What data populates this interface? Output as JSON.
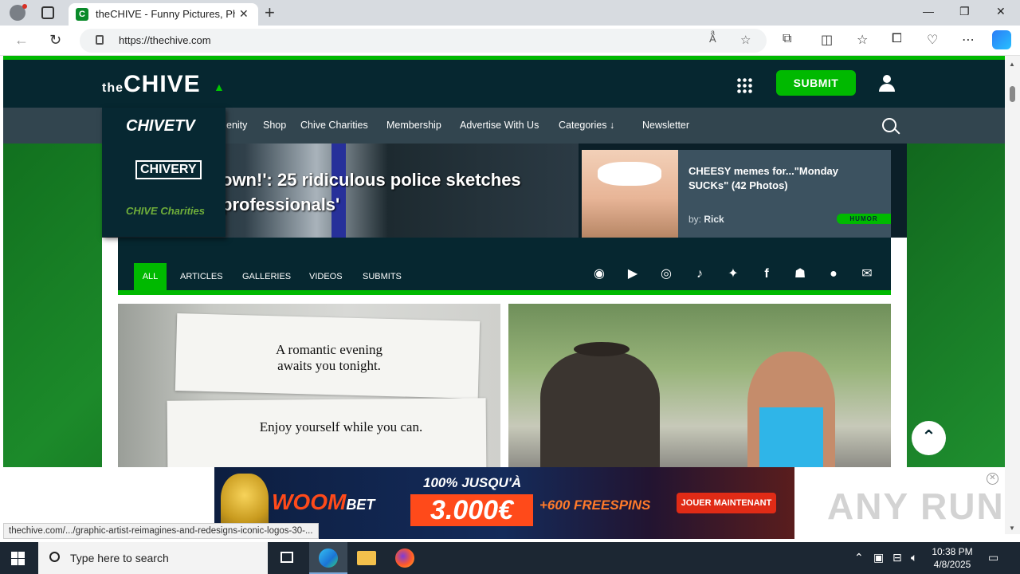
{
  "browser": {
    "tab_title": "theCHIVE - Funny Pictures, Photos",
    "tab_favicon": "C",
    "url": "https://thechive.com"
  },
  "site": {
    "logo_prefix": "the",
    "logo_main": "CHIVE",
    "submit_label": "SUBMIT",
    "nav": [
      "enity",
      "Shop",
      "Chive Charities",
      "Membership",
      "Advertise With Us",
      "Categories",
      "Newsletter"
    ],
    "dropdown": [
      "CHIVETV",
      "CHIVERY",
      "CHIVE Charities"
    ],
    "hero_headline": "own!': 25 ridiculous police sketches professionals'",
    "side_article": {
      "title": "CHEESY memes for...\"Monday SUCKs\" (42 Photos)",
      "by_label": "by:",
      "author": "Rick",
      "tag": "HUMOR"
    },
    "filters": [
      "ALL",
      "ARTICLES",
      "GALLERIES",
      "VIDEOS",
      "SUBMITS"
    ],
    "social_icons": [
      "discord-icon",
      "youtube-icon",
      "instagram-icon",
      "tiktok-icon",
      "twitter-icon",
      "facebook-icon",
      "android-icon",
      "apple-icon",
      "email-icon"
    ],
    "fortune_1": "A romantic evening\nawaits you tonight.",
    "fortune_2": "Enjoy yourself while you can."
  },
  "ad": {
    "brand": "WOOM",
    "brand_suffix": "BET",
    "line1": "100% JUSQU'À",
    "amount": "3.000€",
    "spins": "+600 FREESPINS",
    "cta": "JOUER MAINTENANT"
  },
  "watermark": "ANY RUN",
  "status_url": "thechive.com/.../graphic-artist-reimagines-and-redesigns-iconic-logos-30-...",
  "taskbar": {
    "search_placeholder": "Type here to search",
    "time": "10:38 PM",
    "date": "4/8/2025"
  },
  "colors": {
    "brand_green": "#00b900",
    "header_dark": "#062730",
    "nav_gray": "#32454f"
  }
}
